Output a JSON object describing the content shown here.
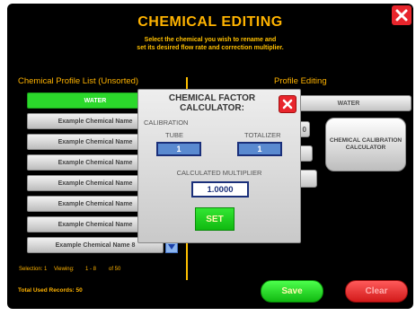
{
  "header": {
    "title": "CHEMICAL EDITING",
    "subtitle_line1": "Select the chemical you wish to rename and",
    "subtitle_line2": "set its desired flow rate and correction multiplier."
  },
  "icons": {
    "close": "close-icon",
    "scroll_down": "arrow-down-icon"
  },
  "colors": {
    "accent": "#ffb300",
    "active_green": "#2bd82b",
    "close_red": "#e8252c"
  },
  "list": {
    "header": "Chemical Profile List (Unsorted)",
    "items": [
      {
        "label": "WATER"
      },
      {
        "label": "Example Chemical Name"
      },
      {
        "label": "Example Chemical Name"
      },
      {
        "label": "Example Chemical Name"
      },
      {
        "label": "Example Chemical Name"
      },
      {
        "label": "Example Chemical Name"
      },
      {
        "label": "Example Chemical Name"
      },
      {
        "label": "Example Chemical Name 8"
      }
    ],
    "selection_label": "Selection: 1",
    "viewing_label": "Viewing:",
    "viewing_range": "1 - 8",
    "of_label": "of 50",
    "total_label": "Total Used Records: 50"
  },
  "profile": {
    "header": "Profile Editing",
    "name": "WATER",
    "field_suffix": "0",
    "calc_button": "CHEMICAL CALIBRATION CALCULATOR",
    "save": "Save",
    "clear": "Clear"
  },
  "dialog": {
    "title": "CHEMICAL FACTOR CALCULATOR:",
    "calibration_label": "CALIBRATION",
    "tube_label": "TUBE",
    "tube_value": "1",
    "totalizer_label": "TOTALIZER",
    "totalizer_value": "1",
    "multiplier_label": "CALCULATED MULTIPLIER",
    "multiplier_value": "1.0000",
    "set_label": "SET"
  }
}
